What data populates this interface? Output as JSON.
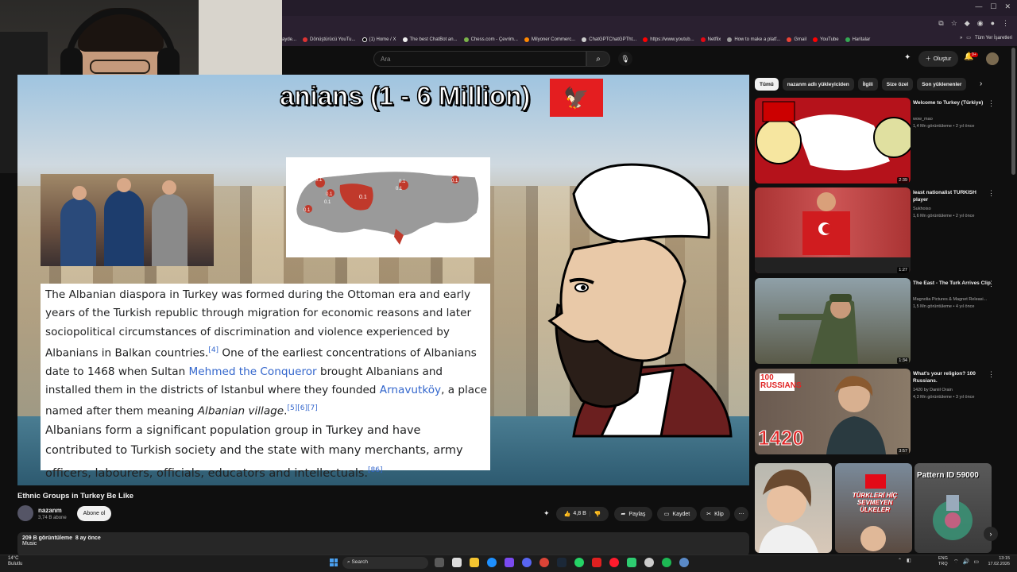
{
  "browser": {
    "bookmarks": [
      "ayde...",
      "Dönüştürücü YouTu...",
      "(1) Home / X",
      "The best ChatBot an...",
      "Chess.com - Çevrim...",
      "Milyoner Commerc...",
      "ChatGPTChatGPTht...",
      "https://www.youtub...",
      "Netflix",
      "How to make a platf...",
      "Gmail",
      "YouTube",
      "Haritalar"
    ],
    "bookmarks_more": "»",
    "all_bookmarks": "Tüm Yer İşaretleri"
  },
  "header": {
    "search_placeholder": "Ara",
    "create_label": "Oluştur",
    "notification_count": "9+"
  },
  "video": {
    "overlay_title": "anians (1 - 6 Million)",
    "map_labels": [
      "0.1",
      "0.1",
      "0.1",
      "0.1",
      "0.1",
      "0.1",
      "0.1",
      "0.1"
    ],
    "wiki_p1_a": "The Albanian diaspora in Turkey was formed during the Ottoman era and early years of the Turkish republic through migration for economic reasons and later sociopolitical circumstances of discrimination and violence experienced by Albanians in Balkan countries.",
    "wiki_p1_ref1": "[4]",
    "wiki_p1_b": " One of the earliest concentrations of Albanians date to 1468 when Sultan ",
    "wiki_p1_link1": "Mehmed the Conqueror",
    "wiki_p1_c": " brought Albanians and installed them in the districts of Istanbul where they founded ",
    "wiki_p1_link2": "Arnavutköy",
    "wiki_p1_d": ", a place named after them meaning ",
    "wiki_p1_italic": "Albanian village",
    "wiki_p1_e": ".",
    "wiki_p1_ref2": "[5][6][7]",
    "wiki_p2": "Albanians form a significant population group in Turkey and have contributed to Turkish society and the state with many merchants, army officers, labourers, officials, educators and intellectuals.",
    "wiki_p2_ref": "[86]",
    "title": "Ethnic Groups in Turkey Be Like",
    "channel": "nazanm",
    "subscribers": "3,74 B abone",
    "subscribe_label": "Abone ol",
    "likes": "4,8 B",
    "share_label": "Paylaş",
    "save_label": "Kaydet",
    "clip_label": "Klip",
    "views": "209 B görüntüleme",
    "age": "8 ay önce",
    "desc": "Music"
  },
  "sidebar": {
    "chips": [
      "Tümü",
      "nazanm adlı yükleyiciden",
      "İlgili",
      "Size özel",
      "Son yüklenenler"
    ],
    "recommendations": [
      {
        "title": "Welcome to Turkey (Türkiye)",
        "channel": "wow_mao",
        "meta": "1,4 Mn görüntüleme • 2 yıl önce",
        "duration": "2:39"
      },
      {
        "title": "least nationalist TURKISH player",
        "channel": "Sukhoiso",
        "meta": "1,6 Mn görüntüleme • 2 yıl önce",
        "duration": "1:27"
      },
      {
        "title": "The East - The Turk Arrives Clip",
        "channel": "Magnolia Pictures & Magnet Releasi...",
        "meta": "1,5 Mn görüntüleme • 4 yıl önce",
        "duration": "1:34"
      },
      {
        "title": "What's your religion? 100 Russians.",
        "channel": "1420 by Daniil Orain",
        "meta": "4,3 Mn görüntüleme • 3 yıl önce",
        "duration": "3:57"
      }
    ],
    "thumb_text_1420": "1420",
    "thumb_text_100": "100 RUSSIANS",
    "shorts_text_1": "TÜRKLERİ HİÇ SEVMEYEN ÜLKELER",
    "shorts_text_2": "Pattern ID 59000"
  },
  "taskbar": {
    "temp": "14°C",
    "weather": "Bulutlu",
    "search_label": "Search",
    "lang_1": "ENG",
    "lang_2": "TRQ",
    "time": "13:15",
    "date": "17.02.2026"
  },
  "colors": {
    "accent": "#cc0000",
    "link": "#3366cc",
    "flag_red": "#e41e20"
  }
}
